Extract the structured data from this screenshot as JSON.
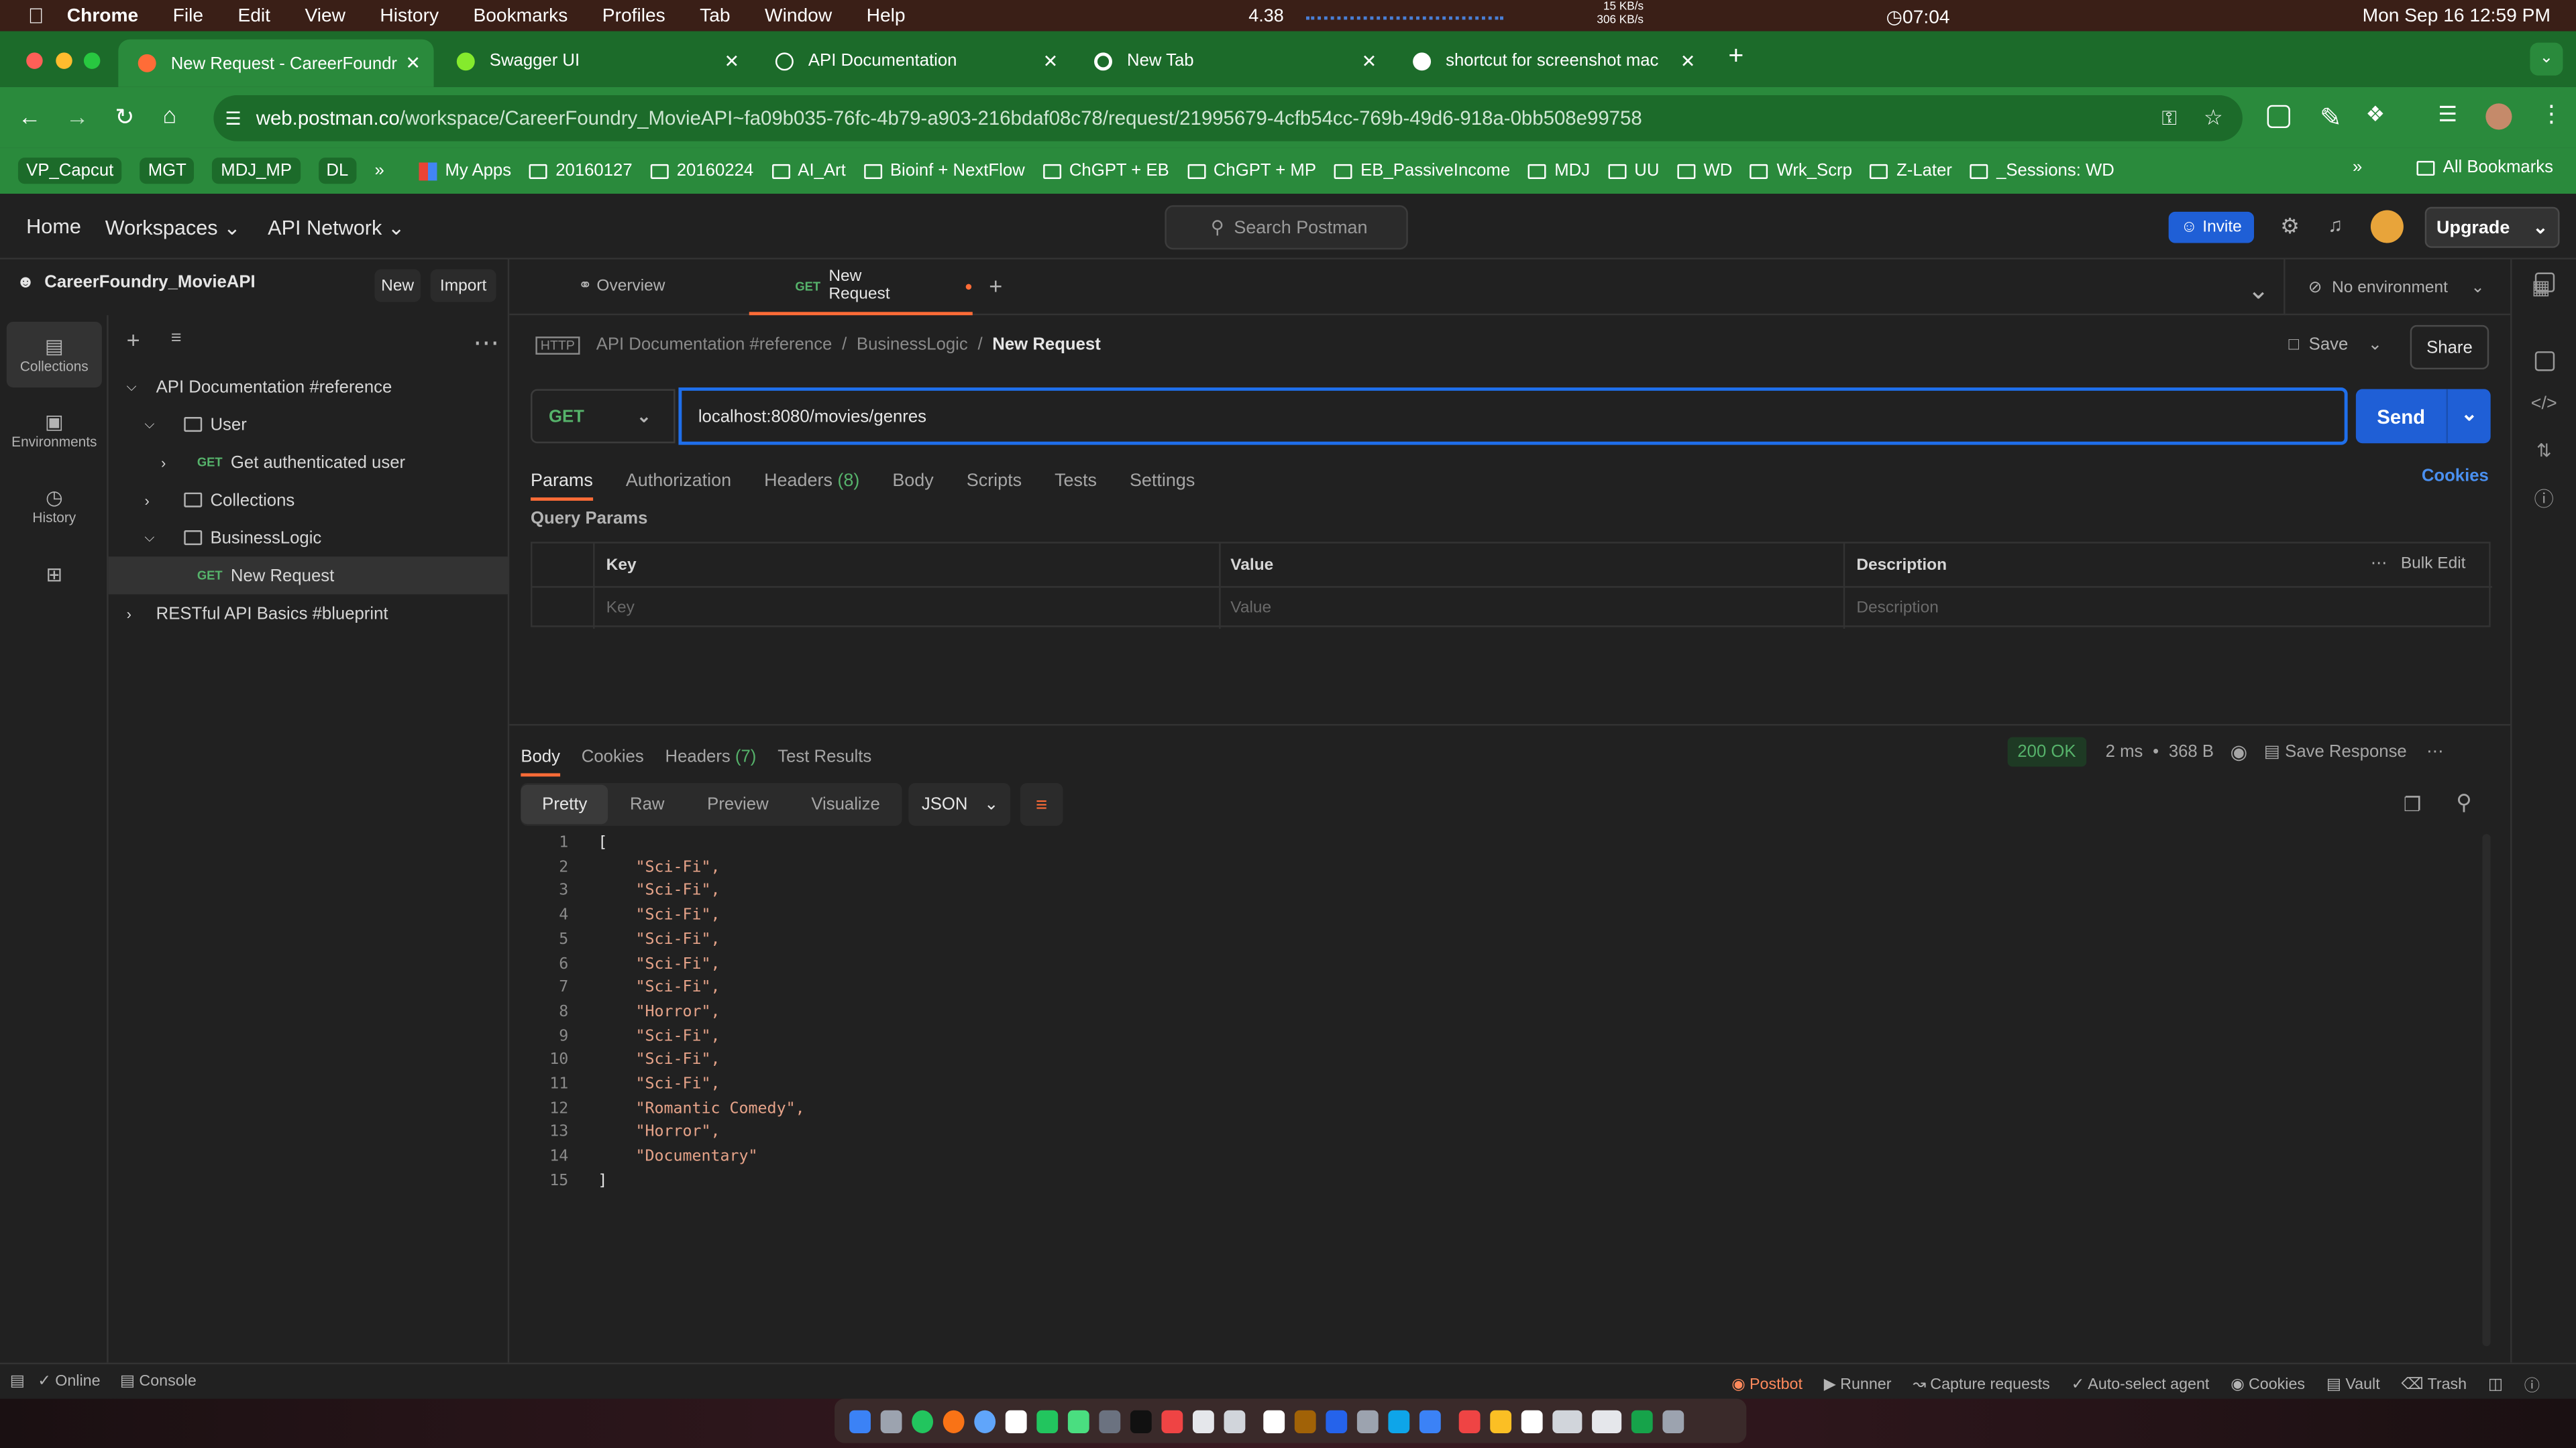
{
  "mac": {
    "app": "Chrome",
    "menus": [
      "File",
      "Edit",
      "View",
      "History",
      "Bookmarks",
      "Profiles",
      "Tab",
      "Window",
      "Help"
    ],
    "net_speed": "4.38",
    "net_up": "15 KB/s",
    "net_down": "306 KB/s",
    "timer": "07:04",
    "date": "Mon Sep 16  12:59 PM"
  },
  "tabs": [
    {
      "title": "New Request - CareerFoundr"
    },
    {
      "title": "Swagger UI"
    },
    {
      "title": "API Documentation"
    },
    {
      "title": "New Tab"
    },
    {
      "title": "shortcut for screenshot mac"
    }
  ],
  "address": {
    "url_host": "web.postman.co",
    "url_path": "/workspace/CareerFoundry_MovieAPI~fa09b035-76fc-4b79-a903-216bdaf08c78/request/21995679-4cfb54cc-769b-49d6-918a-0bb508e99758"
  },
  "bookmarks": {
    "plain": [
      "VP_Capcut",
      "MGT",
      "MDJ_MP",
      "DL"
    ],
    "apps": "My Apps",
    "folders": [
      "20160127",
      "20160224",
      "AI_Art",
      "Bioinf + NextFlow",
      "ChGPT + EB",
      "ChGPT + MP",
      "EB_PassiveIncome",
      "MDJ",
      "UU",
      "WD",
      "Wrk_Scrp",
      "Z-Later",
      "_Sessions: WD"
    ],
    "all": "All Bookmarks"
  },
  "postman": {
    "nav": [
      "Home",
      "Workspaces",
      "API Network"
    ],
    "search": "Search Postman",
    "invite": "Invite",
    "upgrade": "Upgrade"
  },
  "sidebar": {
    "workspace": "CareerFoundry_MovieAPI",
    "new": "New",
    "import": "Import",
    "rail": [
      "Collections",
      "Environments",
      "History"
    ],
    "tree": {
      "c1": "API Documentation #reference",
      "f1": "User",
      "r1": "Get authenticated user",
      "f2": "Collections",
      "f3": "BusinessLogic",
      "r2": "New Request",
      "c2": "RESTful API Basics #blueprint",
      "method": "GET"
    }
  },
  "request": {
    "overview": "Overview",
    "tab_method": "GET",
    "tab_name": "New Request",
    "env": "No environment",
    "crumbs": [
      "API Documentation #reference",
      "BusinessLogic",
      "New Request"
    ],
    "save": "Save",
    "share": "Share",
    "method": "GET",
    "url": "localhost:8080/movies/genres",
    "send": "Send",
    "tabs": [
      "Params",
      "Authorization",
      "Headers",
      "Body",
      "Scripts",
      "Tests",
      "Settings"
    ],
    "headers_count": "(8)",
    "cookies": "Cookies",
    "qp": "Query Params",
    "cols": [
      "Key",
      "Value",
      "Description"
    ],
    "bulk": "Bulk Edit",
    "ph": [
      "Key",
      "Value",
      "Description"
    ]
  },
  "response": {
    "tabs": [
      "Body",
      "Cookies",
      "Headers",
      "Test Results"
    ],
    "headers_count": "(7)",
    "status": "200 OK",
    "time": "2 ms",
    "size": "368 B",
    "save": "Save Response",
    "views": [
      "Pretty",
      "Raw",
      "Preview",
      "Visualize"
    ],
    "format": "JSON",
    "lines": [
      "[",
      "    \"Sci-Fi\",",
      "    \"Sci-Fi\",",
      "    \"Sci-Fi\",",
      "    \"Sci-Fi\",",
      "    \"Sci-Fi\",",
      "    \"Sci-Fi\",",
      "    \"Horror\",",
      "    \"Sci-Fi\",",
      "    \"Sci-Fi\",",
      "    \"Sci-Fi\",",
      "    \"Romantic Comedy\",",
      "    \"Horror\",",
      "    \"Documentary\"",
      "]"
    ]
  },
  "statusbar": {
    "online": "Online",
    "console": "Console",
    "right": [
      "Postbot",
      "Runner",
      "Capture requests",
      "Auto-select agent",
      "Cookies",
      "Vault",
      "Trash"
    ]
  }
}
